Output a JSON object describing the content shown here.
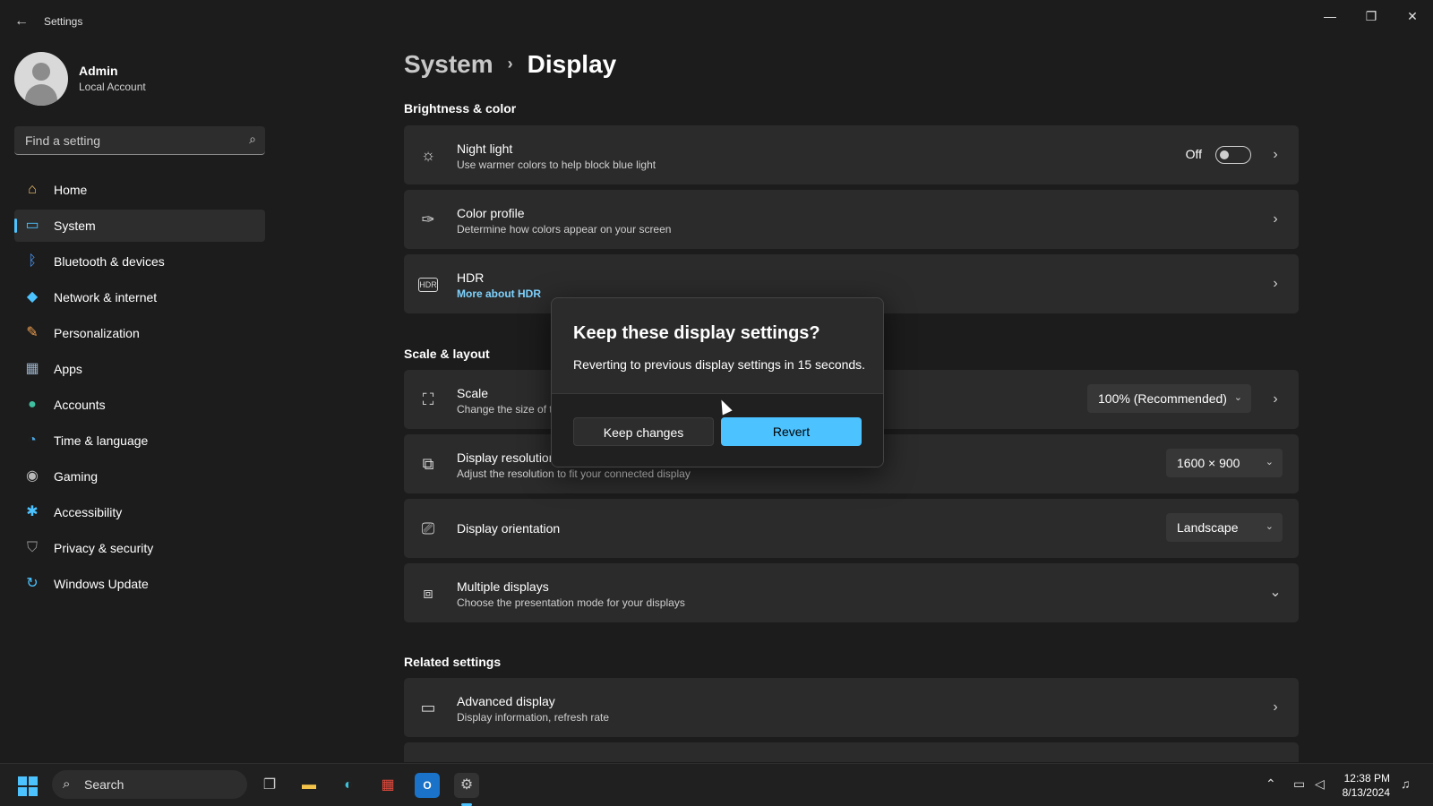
{
  "window": {
    "title": "Settings",
    "back_icon": "back-arrow-icon",
    "controls": [
      "minimize-icon",
      "restore-icon",
      "close-icon"
    ]
  },
  "profile": {
    "name": "Admin",
    "account_type": "Local Account"
  },
  "search": {
    "placeholder": "Find a setting"
  },
  "sidebar": {
    "items": [
      {
        "label": "Home",
        "icon": "home-icon"
      },
      {
        "label": "System",
        "icon": "system-icon",
        "active": true
      },
      {
        "label": "Bluetooth & devices",
        "icon": "bluetooth-icon"
      },
      {
        "label": "Network & internet",
        "icon": "wifi-icon"
      },
      {
        "label": "Personalization",
        "icon": "brush-icon"
      },
      {
        "label": "Apps",
        "icon": "apps-icon"
      },
      {
        "label": "Accounts",
        "icon": "accounts-icon"
      },
      {
        "label": "Time & language",
        "icon": "globe-clock-icon"
      },
      {
        "label": "Gaming",
        "icon": "gamepad-icon"
      },
      {
        "label": "Accessibility",
        "icon": "accessibility-icon"
      },
      {
        "label": "Privacy & security",
        "icon": "shield-icon"
      },
      {
        "label": "Windows Update",
        "icon": "update-icon"
      }
    ]
  },
  "breadcrumb": {
    "parent": "System",
    "separator": "›",
    "current": "Display"
  },
  "sections": {
    "brightness": "Brightness & color",
    "scale": "Scale & layout",
    "related": "Related settings"
  },
  "cards": {
    "night_light": {
      "title": "Night light",
      "subtitle": "Use warmer colors to help block blue light",
      "toggle_label": "Off",
      "toggle_on": false
    },
    "color_profile": {
      "title": "Color profile",
      "subtitle": "Determine how colors appear on your screen"
    },
    "hdr": {
      "title": "HDR",
      "link": "More about HDR"
    },
    "scale": {
      "title": "Scale",
      "subtitle": "Change the size of t",
      "value": "100% (Recommended)"
    },
    "resolution": {
      "title": "Display resolution",
      "subtitle": "Adjust the resolution to fit your connected display",
      "value": "1600 × 900"
    },
    "orientation": {
      "title": "Display orientation",
      "value": "Landscape"
    },
    "multiple": {
      "title": "Multiple displays",
      "subtitle": "Choose the presentation mode for your displays"
    },
    "advanced": {
      "title": "Advanced display",
      "subtitle": "Display information, refresh rate"
    }
  },
  "dialog": {
    "title": "Keep these display settings?",
    "message": "Reverting to previous display settings in 15 seconds.",
    "keep_label": "Keep changes",
    "revert_label": "Revert"
  },
  "taskbar": {
    "search_label": "Search",
    "time": "12:38 PM",
    "date": "8/13/2024"
  },
  "colors": {
    "accent": "#4cc2ff",
    "background": "#1c1c1c",
    "card": "#2b2b2b"
  }
}
